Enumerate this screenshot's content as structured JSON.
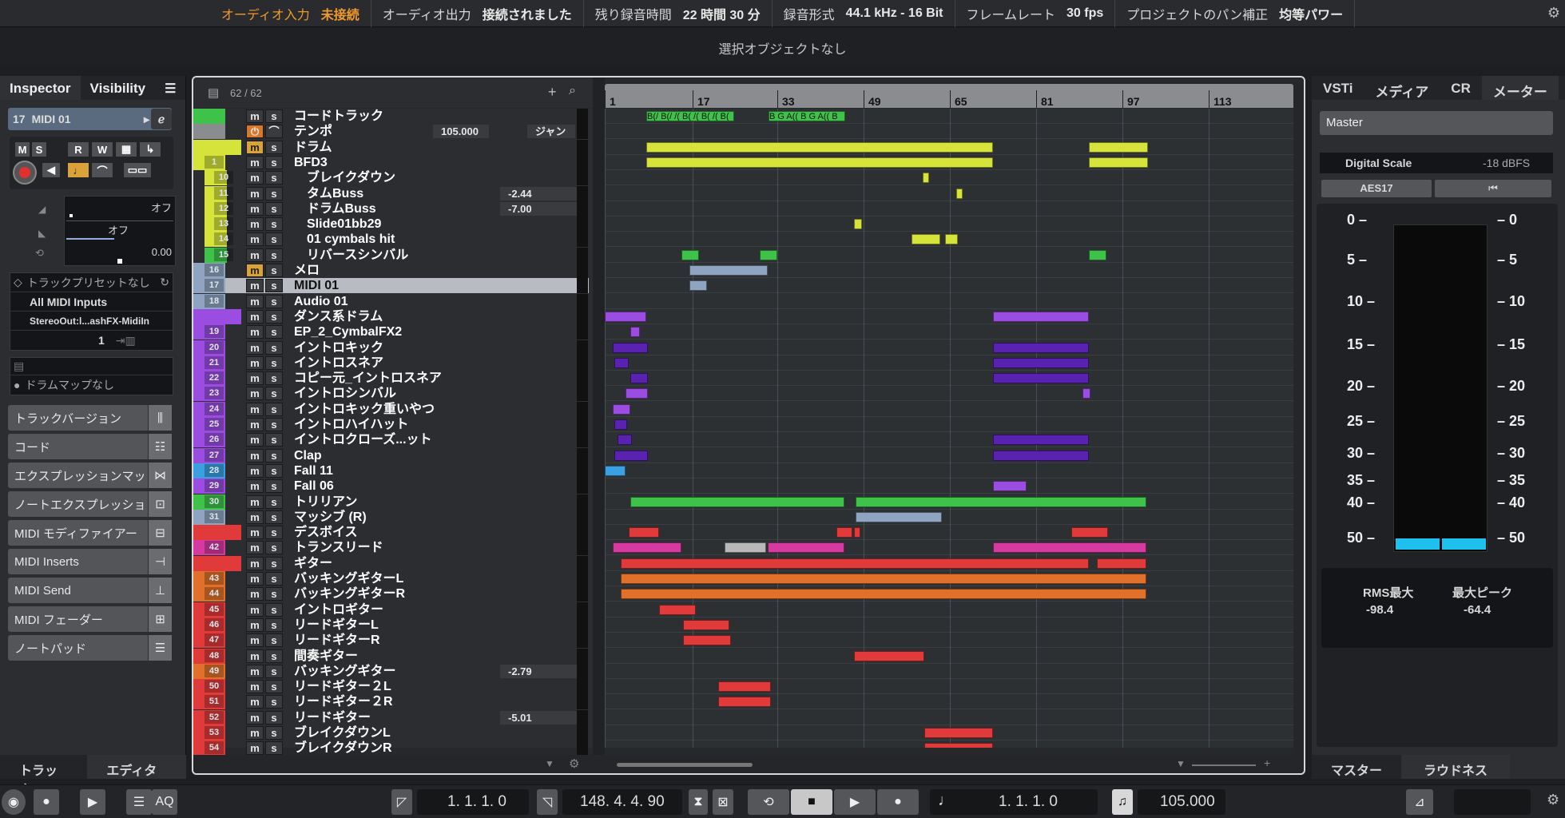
{
  "status": {
    "audio_in_label": "オーディオ入力",
    "audio_in_value": "未接続",
    "audio_out_label": "オーディオ出力",
    "audio_out_value": "接続されました",
    "rec_time_label": "残り録音時間",
    "rec_time_value": "22 時間 30 分",
    "rec_format_label": "録音形式",
    "rec_format_value": "44.1 kHz - 16 Bit",
    "frame_label": "フレームレート",
    "frame_value": "30 fps",
    "pan_label": "プロジェクトのパン補正",
    "pan_value": "均等パワー"
  },
  "selection_text": "選択オブジェクトなし",
  "inspector": {
    "tab_inspector": "Inspector",
    "tab_visibility": "Visibility",
    "track_number": "17",
    "track_name": "MIDI 01",
    "btn_m": "M",
    "btn_s": "S",
    "btn_r": "R",
    "btn_w": "W",
    "vol_value": "オフ",
    "pan_value": "オフ",
    "transpose_value": "0.00",
    "preset": "トラックプリセットなし",
    "midi_in": "All MIDI Inputs",
    "midi_out": "StereoOut:l...ashFX-MidiIn",
    "channel": "1",
    "drum_map": "ドラムマップなし",
    "sections": [
      "トラックバージョン",
      "コード",
      "エクスプレッションマッ",
      "ノートエクスプレッショ",
      "MIDI モディファイアー",
      "MIDI Inserts",
      "MIDI Send",
      "MIDI フェーダー",
      "ノートパッド"
    ],
    "bottom_tab_track": "トラック",
    "bottom_tab_editor": "エディター"
  },
  "project": {
    "track_count": "62 / 62",
    "ruler": [
      "1",
      "17",
      "33",
      "49",
      "65",
      "81",
      "97",
      "113"
    ],
    "tempo_value": "105.000",
    "tempo_mode": "ジャン",
    "chord_events": "B(/ B(/ /( B( /( B( /( B(",
    "chord_events2": "B G A(( B G A(( B",
    "tracks": [
      {
        "name": "コードトラック",
        "num": "",
        "color": "#3ec24a",
        "type": "chord"
      },
      {
        "name": "テンポ",
        "num": "",
        "color": "#8a8c90",
        "type": "tempo"
      },
      {
        "name": "ドラム",
        "num": "",
        "color": "#d6e33a",
        "type": "folder"
      },
      {
        "name": "BFD3",
        "num": "1",
        "color": "#d6e33a",
        "type": "inst"
      },
      {
        "name": "ブレイクダウン",
        "num": "10",
        "color": "#d6e33a",
        "type": "inst",
        "indent": true
      },
      {
        "name": "タムBuss",
        "num": "11",
        "color": "#d6e33a",
        "type": "inst",
        "indent": true,
        "val": "-2.44"
      },
      {
        "name": "ドラムBuss",
        "num": "12",
        "color": "#d6e33a",
        "type": "inst",
        "indent": true,
        "val": "-7.00"
      },
      {
        "name": "Slide01bb29",
        "num": "13",
        "color": "#d6e33a",
        "type": "inst",
        "indent": true
      },
      {
        "name": "01 cymbals hit",
        "num": "14",
        "color": "#d6e33a",
        "type": "inst",
        "indent": true
      },
      {
        "name": "リバースシンバル",
        "num": "15",
        "color": "#3ec24a",
        "type": "inst",
        "indent": true
      },
      {
        "name": "メロ",
        "num": "16",
        "color": "#8ea4c0",
        "type": "inst"
      },
      {
        "name": "MIDI 01",
        "num": "17",
        "color": "#8ea4c0",
        "type": "midi",
        "selected": true
      },
      {
        "name": "Audio 01",
        "num": "18",
        "color": "#8ea4c0",
        "type": "audio"
      },
      {
        "name": "ダンス系ドラム",
        "num": "",
        "color": "#9a4de0",
        "type": "folder"
      },
      {
        "name": "EP_2_CymbalFX2",
        "num": "19",
        "color": "#9a4de0",
        "type": "inst"
      },
      {
        "name": "イントロキック",
        "num": "20",
        "color": "#9a4de0",
        "type": "inst"
      },
      {
        "name": "イントロスネア",
        "num": "21",
        "color": "#9a4de0",
        "type": "inst"
      },
      {
        "name": "コピー元_イントロスネア",
        "num": "22",
        "color": "#9a4de0",
        "type": "inst"
      },
      {
        "name": "イントロシンバル",
        "num": "23",
        "color": "#9a4de0",
        "type": "inst"
      },
      {
        "name": "イントロキック重いやつ",
        "num": "24",
        "color": "#9a4de0",
        "type": "inst"
      },
      {
        "name": "イントロハイハット",
        "num": "25",
        "color": "#9a4de0",
        "type": "inst"
      },
      {
        "name": "イントロクローズ...ット",
        "num": "26",
        "color": "#9a4de0",
        "type": "inst"
      },
      {
        "name": "Clap",
        "num": "27",
        "color": "#9a4de0",
        "type": "inst"
      },
      {
        "name": "Fall 11",
        "num": "28",
        "color": "#3aa0e0",
        "type": "inst"
      },
      {
        "name": "Fall 06",
        "num": "29",
        "color": "#9a4de0",
        "type": "inst"
      },
      {
        "name": "トリリアン",
        "num": "30",
        "color": "#3ec24a",
        "type": "inst"
      },
      {
        "name": "マッシブ (R)",
        "num": "31",
        "color": "#8ea4c0",
        "type": "inst"
      },
      {
        "name": "デスボイス",
        "num": "",
        "color": "#e03a3a",
        "type": "folder"
      },
      {
        "name": "トランスリード",
        "num": "42",
        "color": "#d63aa0",
        "type": "inst"
      },
      {
        "name": "ギター",
        "num": "",
        "color": "#e03a3a",
        "type": "folder"
      },
      {
        "name": "バッキングギターL",
        "num": "43",
        "color": "#e0702a",
        "type": "inst"
      },
      {
        "name": "バッキングギターR",
        "num": "44",
        "color": "#e0702a",
        "type": "inst"
      },
      {
        "name": "イントロギター",
        "num": "45",
        "color": "#e03a3a",
        "type": "inst"
      },
      {
        "name": "リードギターL",
        "num": "46",
        "color": "#e03a3a",
        "type": "inst"
      },
      {
        "name": "リードギターR",
        "num": "47",
        "color": "#e03a3a",
        "type": "inst"
      },
      {
        "name": "間奏ギター",
        "num": "48",
        "color": "#e03a3a",
        "type": "inst"
      },
      {
        "name": "バッキングギター",
        "num": "49",
        "color": "#e0702a",
        "type": "inst",
        "val": "-2.79"
      },
      {
        "name": "リードギター２L",
        "num": "50",
        "color": "#e03a3a",
        "type": "inst"
      },
      {
        "name": "リードギター２R",
        "num": "51",
        "color": "#e03a3a",
        "type": "inst"
      },
      {
        "name": "リードギター",
        "num": "52",
        "color": "#e03a3a",
        "type": "inst",
        "val": "-5.01"
      },
      {
        "name": "ブレイクダウンL",
        "num": "53",
        "color": "#e03a3a",
        "type": "inst"
      },
      {
        "name": "ブレイクダウンR",
        "num": "54",
        "color": "#e03a3a",
        "type": "inst"
      }
    ]
  },
  "right": {
    "tabs": [
      "VSTi",
      "メディア",
      "CR",
      "メーター"
    ],
    "output": "Master",
    "scale_label": "Digital Scale",
    "scale_value": "-18 dBFS",
    "aes": "AES17",
    "reset": "⏮",
    "scale": [
      "0",
      "5",
      "10",
      "15",
      "20",
      "25",
      "30",
      "35",
      "40",
      "50"
    ],
    "rms_label": "RMS最大",
    "rms_value": "-98.4",
    "peak_label": "最大ピーク",
    "peak_value": "-64.4",
    "tab_master": "マスター",
    "tab_loudness": "ラウドネス"
  },
  "transport": {
    "left_locator": "1. 1. 1.   0",
    "right_locator": "148. 4. 4.  90",
    "position": "1. 1. 1.   0",
    "tempo": "105.000",
    "aq": "AQ"
  }
}
